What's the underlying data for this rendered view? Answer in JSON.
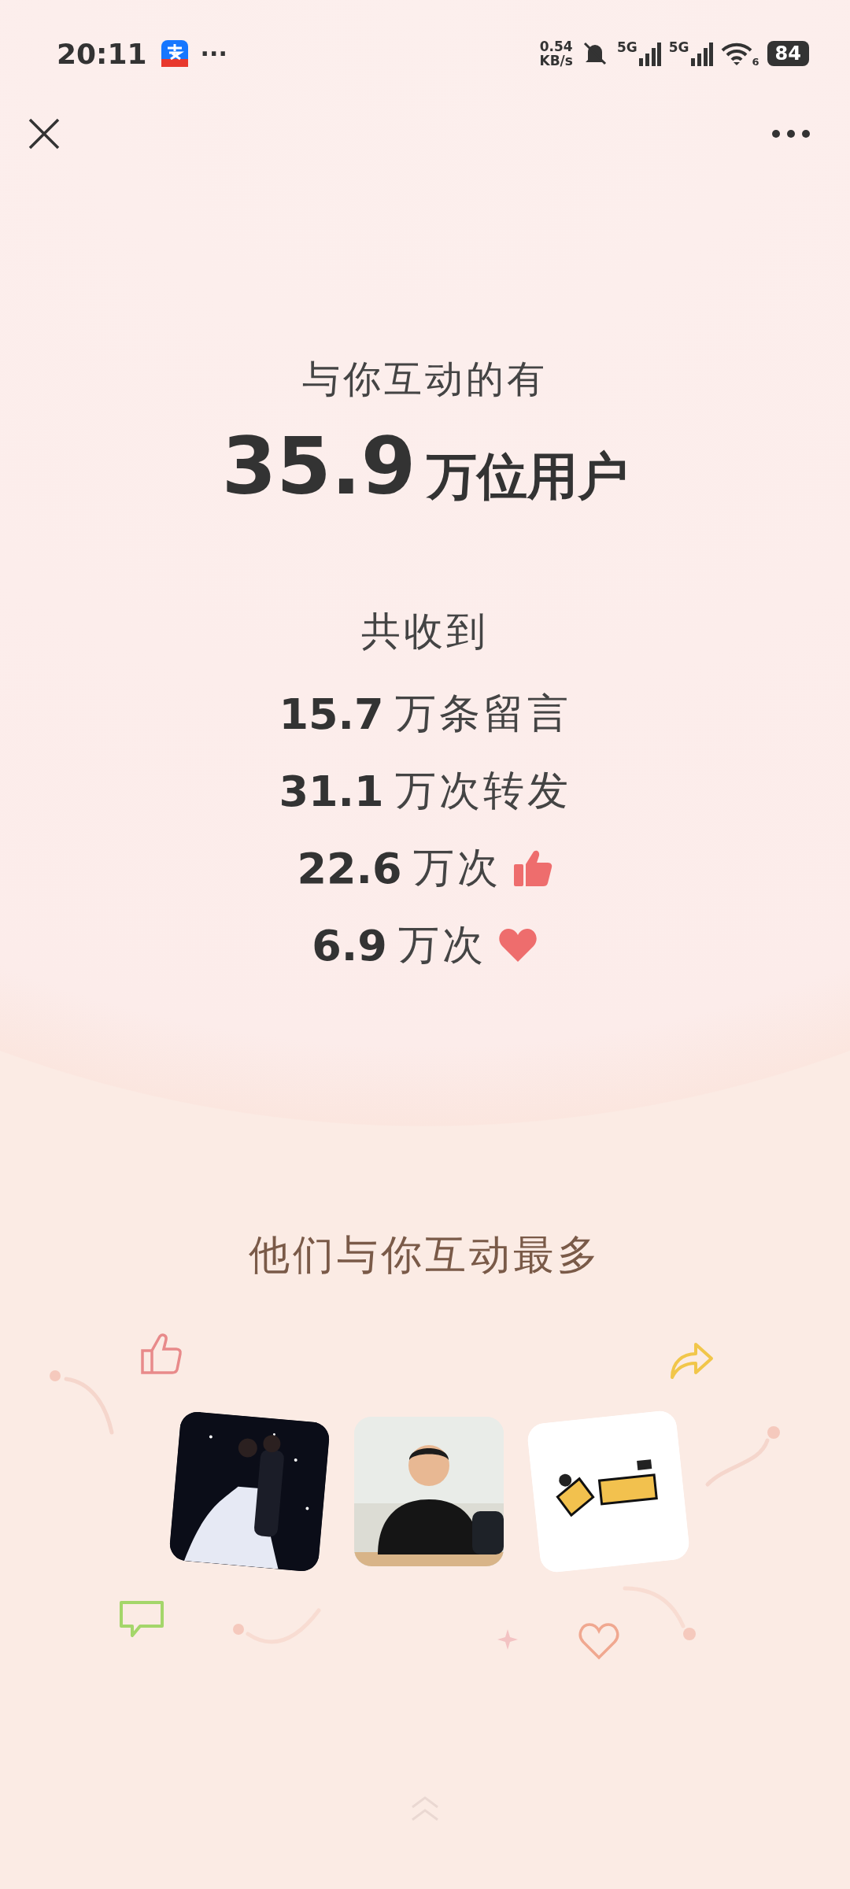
{
  "status_bar": {
    "time": "20:11",
    "more": "···",
    "speed_value": "0.54",
    "speed_unit": "KB/s",
    "sim_1": "5G",
    "sim_2": "5G",
    "wifi_label": "6",
    "battery": "84"
  },
  "summary": {
    "heading": "与你互动的有",
    "count": "35.9",
    "count_unit": "万位用户"
  },
  "received": {
    "heading": "共收到",
    "items": [
      {
        "kind": "text",
        "number": "15.7",
        "unit": "万条留言"
      },
      {
        "kind": "text",
        "number": "31.1",
        "unit": "万次转发"
      },
      {
        "kind": "like",
        "number": "22.6",
        "unit": "万次"
      },
      {
        "kind": "heart",
        "number": "6.9",
        "unit": "万次"
      }
    ]
  },
  "top_users": {
    "heading": "他们与你互动最多"
  }
}
